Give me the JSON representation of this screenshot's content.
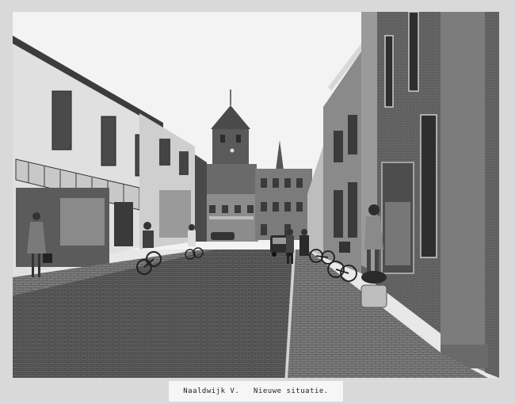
{
  "caption": {
    "text": "Naaldwijk V.   Nieuwe situatie."
  },
  "scene": {
    "palette": {
      "sky": "#f2f2f2",
      "road": "#5a5a5a",
      "sidewalk": "#7a7a7a",
      "building_light": "#dcdcdc",
      "building_dark": "#3a3a3a",
      "brick": "#6e6e6e"
    }
  }
}
